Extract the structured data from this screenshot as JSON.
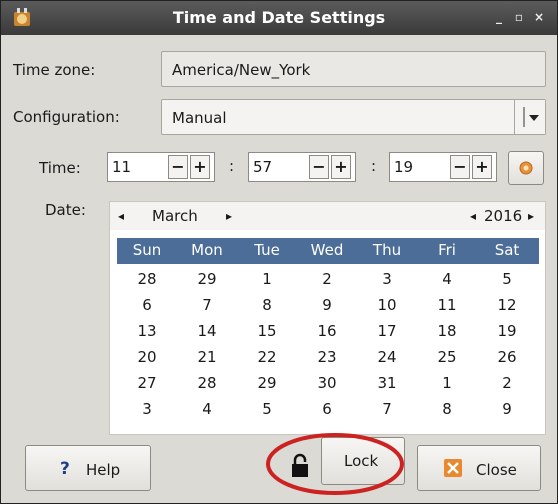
{
  "window": {
    "title": "Time and Date Settings",
    "controls": [
      "_",
      "▫",
      "×"
    ]
  },
  "timezone": {
    "label": "Time zone:",
    "value": "America/New_York"
  },
  "configuration": {
    "label": "Configuration:",
    "value": "Manual"
  },
  "time": {
    "label": "Time:",
    "hours": "11",
    "minutes": "57",
    "seconds": "19",
    "separator": ":",
    "minus": "−",
    "plus": "+"
  },
  "date": {
    "label": "Date:",
    "month": "March",
    "year": "2016",
    "prev": "◂",
    "next": "▸",
    "weekdays": [
      "Sun",
      "Mon",
      "Tue",
      "Wed",
      "Thu",
      "Fri",
      "Sat"
    ],
    "weeks": [
      [
        "28",
        "29",
        "1",
        "2",
        "3",
        "4",
        "5"
      ],
      [
        "6",
        "7",
        "8",
        "9",
        "10",
        "11",
        "12"
      ],
      [
        "13",
        "14",
        "15",
        "16",
        "17",
        "18",
        "19"
      ],
      [
        "20",
        "21",
        "22",
        "23",
        "24",
        "25",
        "26"
      ],
      [
        "27",
        "28",
        "29",
        "30",
        "31",
        "1",
        "2"
      ],
      [
        "3",
        "4",
        "5",
        "6",
        "7",
        "8",
        "9"
      ]
    ]
  },
  "buttons": {
    "help": "Help",
    "help_glyph": "?",
    "lock": "Lock",
    "close": "Close"
  },
  "colors": {
    "header_blue": "#4b6d98",
    "highlight_red": "#cc2222"
  }
}
